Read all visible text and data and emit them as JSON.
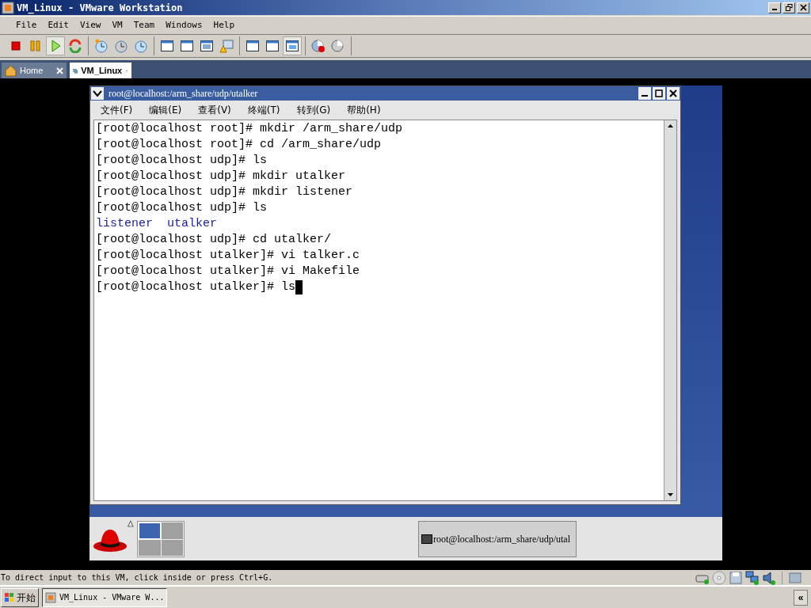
{
  "window": {
    "title": "VM_Linux - VMware Workstation"
  },
  "menu": [
    "File",
    "Edit",
    "View",
    "VM",
    "Team",
    "Windows",
    "Help"
  ],
  "toolbar": [
    [
      {
        "kind": "stop",
        "pressed": false
      },
      {
        "kind": "pause",
        "pressed": false
      },
      {
        "kind": "play",
        "pressed": true
      },
      {
        "kind": "reset",
        "pressed": false
      }
    ],
    [
      {
        "kind": "snapshot",
        "pressed": false
      },
      {
        "kind": "revert",
        "pressed": false
      },
      {
        "kind": "manager",
        "pressed": false
      }
    ],
    [
      {
        "kind": "window",
        "pressed": false
      },
      {
        "kind": "fullscreen",
        "pressed": false
      },
      {
        "kind": "fit",
        "pressed": false
      },
      {
        "kind": "warning",
        "pressed": false
      }
    ],
    [
      {
        "kind": "settings",
        "pressed": false
      },
      {
        "kind": "console",
        "pressed": false
      },
      {
        "kind": "tabs",
        "pressed": true
      }
    ],
    [
      {
        "kind": "record",
        "pressed": false
      },
      {
        "kind": "replay",
        "pressed": false
      }
    ]
  ],
  "tabs": [
    {
      "label": "Home",
      "kind": "home",
      "selected": false
    },
    {
      "label": "VM_Linux",
      "kind": "vm",
      "selected": true
    }
  ],
  "terminal": {
    "title": "root@localhost:/arm_share/udp/utalker",
    "menu": [
      "文件(F)",
      "编辑(E)",
      "查看(V)",
      "终端(T)",
      "转到(G)",
      "帮助(H)"
    ],
    "lines": [
      {
        "kind": "prompt",
        "text": "[root@localhost root]# mkdir /arm_share/udp"
      },
      {
        "kind": "prompt",
        "text": "[root@localhost root]# cd /arm_share/udp"
      },
      {
        "kind": "prompt",
        "text": "[root@localhost udp]# ls"
      },
      {
        "kind": "prompt",
        "text": "[root@localhost udp]# mkdir utalker"
      },
      {
        "kind": "prompt",
        "text": "[root@localhost udp]# mkdir listener"
      },
      {
        "kind": "prompt",
        "text": "[root@localhost udp]# ls"
      },
      {
        "kind": "listing",
        "text": "listener  utalker"
      },
      {
        "kind": "prompt",
        "text": "[root@localhost udp]# cd utalker/"
      },
      {
        "kind": "prompt",
        "text": "[root@localhost utalker]# vi talker.c"
      },
      {
        "kind": "prompt",
        "text": "[root@localhost utalker]# vi Makefile"
      },
      {
        "kind": "prompt",
        "text": "[root@localhost utalker]# ls"
      }
    ],
    "cursor": true
  },
  "guest_panel": {
    "arrow": "△",
    "workspaces": [
      {
        "selected": true
      },
      {
        "selected": false
      },
      {
        "selected": false
      },
      {
        "selected": false
      }
    ],
    "task": "root@localhost:/arm_share/udp/utal"
  },
  "status_bar": {
    "text": "To direct input to this VM, click inside or press Ctrl+G.",
    "devices": [
      {
        "kind": "disk"
      },
      {
        "kind": "cdrom"
      },
      {
        "kind": "floppy"
      },
      {
        "kind": "network"
      },
      {
        "kind": "sound"
      }
    ]
  },
  "taskbar": {
    "start": "开始",
    "task": "VM_Linux - VMware W...",
    "collapse": "«"
  }
}
